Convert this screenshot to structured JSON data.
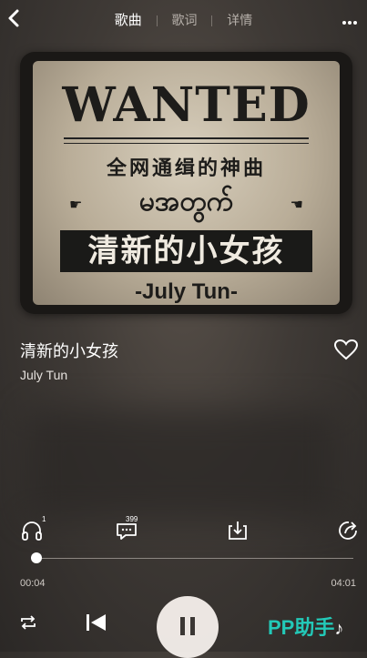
{
  "header": {
    "tabs": [
      {
        "label": "歌曲",
        "active": true
      },
      {
        "label": "歌词",
        "active": false
      },
      {
        "label": "详情",
        "active": false
      }
    ]
  },
  "poster": {
    "headline": "WANTED",
    "subtitle": "全网通缉的神曲",
    "burmese": "မအတွက်",
    "banner": "清新的小女孩",
    "artist": "-July Tun-"
  },
  "song": {
    "title": "清新的小女孩",
    "artist": "July Tun"
  },
  "actions": {
    "listen_count": "1",
    "comment_count": "399"
  },
  "progress": {
    "current": "00:04",
    "total": "04:01",
    "fraction": 0.017
  },
  "watermark": {
    "prefix": "PP",
    "text": "助手",
    "note": "♪"
  },
  "colors": {
    "accent": "#23c9b8",
    "background": "#3f3a36"
  }
}
